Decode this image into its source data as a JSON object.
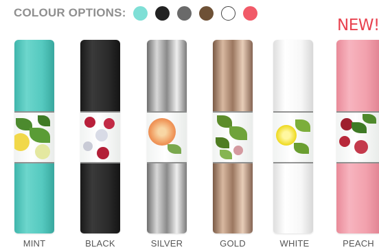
{
  "header": {
    "label": "COLOUR OPTIONS:",
    "swatches": [
      {
        "name": "mint",
        "color": "#7fdfd6"
      },
      {
        "name": "black",
        "color": "#222222"
      },
      {
        "name": "grey",
        "color": "#6a6a6a"
      },
      {
        "name": "brown",
        "color": "#6e5136"
      },
      {
        "name": "white",
        "color": "#ffffff"
      },
      {
        "name": "pink",
        "color": "#f15a68"
      }
    ]
  },
  "badge": {
    "text": "NEW!"
  },
  "products": [
    {
      "label": "MINT"
    },
    {
      "label": "BLACK"
    },
    {
      "label": "SILVER"
    },
    {
      "label": "GOLD"
    },
    {
      "label": "WHITE"
    },
    {
      "label": "PEACH"
    }
  ]
}
